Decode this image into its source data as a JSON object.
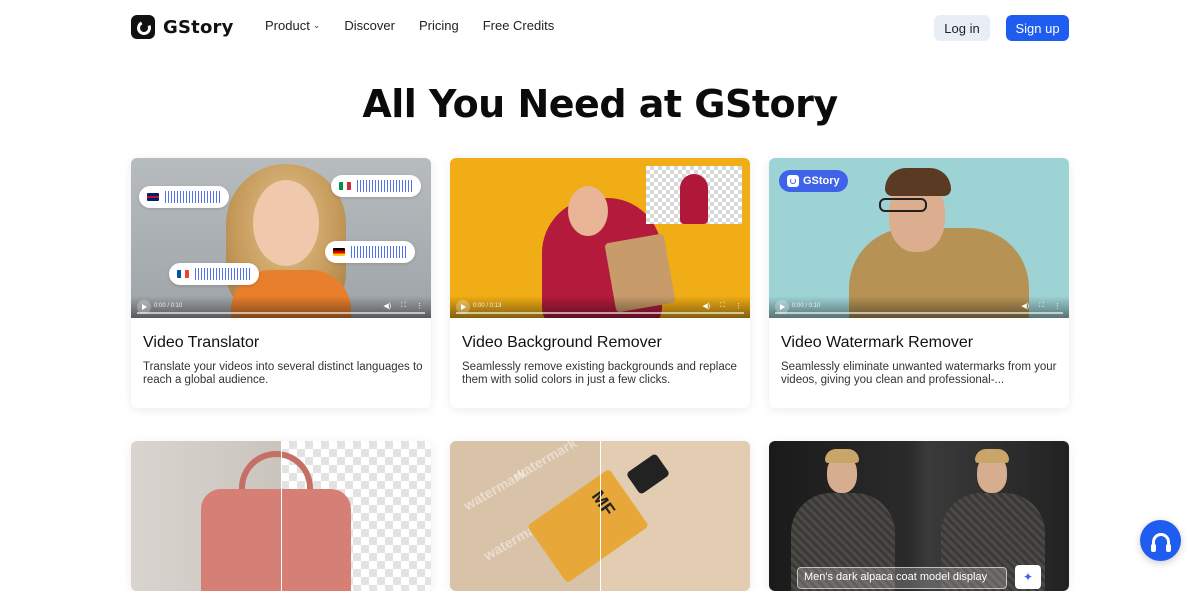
{
  "header": {
    "logo_text": "GStory",
    "nav": [
      {
        "label": "Product",
        "has_dropdown": true
      },
      {
        "label": "Discover"
      },
      {
        "label": "Pricing"
      },
      {
        "label": "Free Credits"
      }
    ],
    "login_label": "Log in",
    "signup_label": "Sign up"
  },
  "page_title": "All You Need at GStory",
  "cards": [
    {
      "title": "Video Translator",
      "description": "Translate your videos into several distinct languages to reach a global audience.",
      "video_time": "0:00 / 0:10"
    },
    {
      "title": "Video Background Remover",
      "description": "Seamlessly remove existing backgrounds and replace them with solid colors in just a few clicks.",
      "video_time": "0:00 / 0:13"
    },
    {
      "title": "Video Watermark Remover",
      "description": "Seamlessly eliminate unwanted watermarks from your videos, giving you clean and professional-...",
      "video_time": "0:00 / 0:10",
      "badge": "GStory"
    }
  ],
  "row2": {
    "watermark_text": "watermark",
    "bottle_label": "MF",
    "caption_text": "Men's dark alpaca coat model display"
  },
  "icons": {
    "support": "headset-icon",
    "chevron": "chevron-down-icon"
  },
  "colors": {
    "primary": "#1f5cf0",
    "login_bg": "#e9edf5",
    "waveform": "#3e63e8"
  }
}
